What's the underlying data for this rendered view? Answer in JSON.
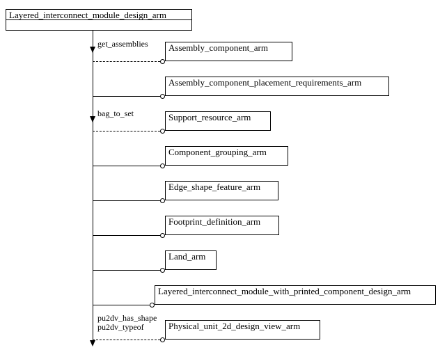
{
  "root": {
    "label": "Layered_interconnect_module_design_arm"
  },
  "children": [
    {
      "label": "Assembly_component_arm"
    },
    {
      "label": "Assembly_component_placement_requirements_arm"
    },
    {
      "label": "Support_resource_arm"
    },
    {
      "label": "Component_grouping_arm"
    },
    {
      "label": "Edge_shape_feature_arm"
    },
    {
      "label": "Footprint_definition_arm"
    },
    {
      "label": "Land_arm"
    },
    {
      "label": "Layered_interconnect_module_with_printed_component_design_arm"
    },
    {
      "label": "Physical_unit_2d_design_view_arm"
    }
  ],
  "edge_labels": {
    "e1": "get_assemblies",
    "e3": "bag_to_set",
    "e9_line1": "pu2dv_has_shape",
    "e9_line2": "pu2dv_typeof"
  }
}
